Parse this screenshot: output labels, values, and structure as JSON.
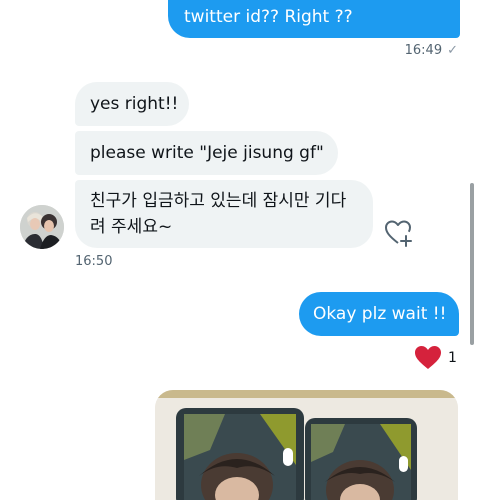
{
  "messages": {
    "sent_top": {
      "text": "twitter id?? Right ??",
      "time": "16:49",
      "status_icon": "single-check-icon"
    },
    "received": [
      {
        "text": "yes right!!"
      },
      {
        "text": "please write \"Jeje jisung gf\""
      },
      {
        "text": "친구가 입금하고 있는데 잠시만 기다려 주세요~"
      }
    ],
    "received_time": "16:50",
    "sent_reply": {
      "text": "Okay plz wait !!"
    },
    "reaction": {
      "icon": "red-heart-icon",
      "count": "1"
    }
  },
  "icons": {
    "add_reaction": "heart-plus-icon",
    "avatar": "user-avatar-photo"
  },
  "colors": {
    "sent_bubble": "#1d9bf0",
    "received_bubble": "#eff3f4",
    "reaction_heart": "#d5223c",
    "timestamp": "#536471"
  }
}
